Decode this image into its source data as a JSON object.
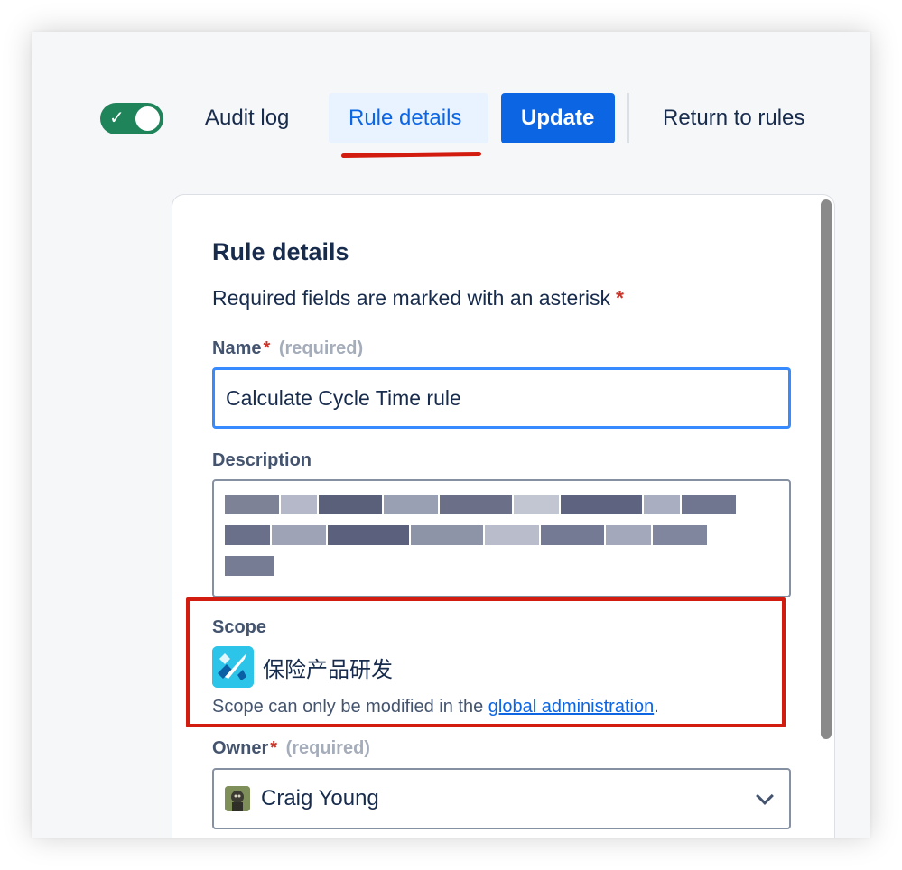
{
  "toolbar": {
    "audit_log": "Audit log",
    "rule_details": "Rule details",
    "update": "Update",
    "return_to_rules": "Return to rules"
  },
  "rule_details": {
    "title": "Rule details",
    "required_note": "Required fields are marked with an asterisk",
    "asterisk": "*",
    "name": {
      "label": "Name",
      "required": "(required)",
      "value": "Calculate Cycle Time rule"
    },
    "description": {
      "label": "Description"
    },
    "scope": {
      "label": "Scope",
      "project": "保险产品研发",
      "note_prefix": "Scope can only be modified in the ",
      "link": "global administration",
      "note_suffix": "."
    },
    "owner": {
      "label": "Owner",
      "required": "(required)",
      "value": "Craig Young"
    }
  },
  "colors": {
    "toggle_on": "#1f845a",
    "primary": "#0c66e4",
    "selected_tab_bg": "#e9f2ff",
    "annotation_red": "#d21c10"
  }
}
